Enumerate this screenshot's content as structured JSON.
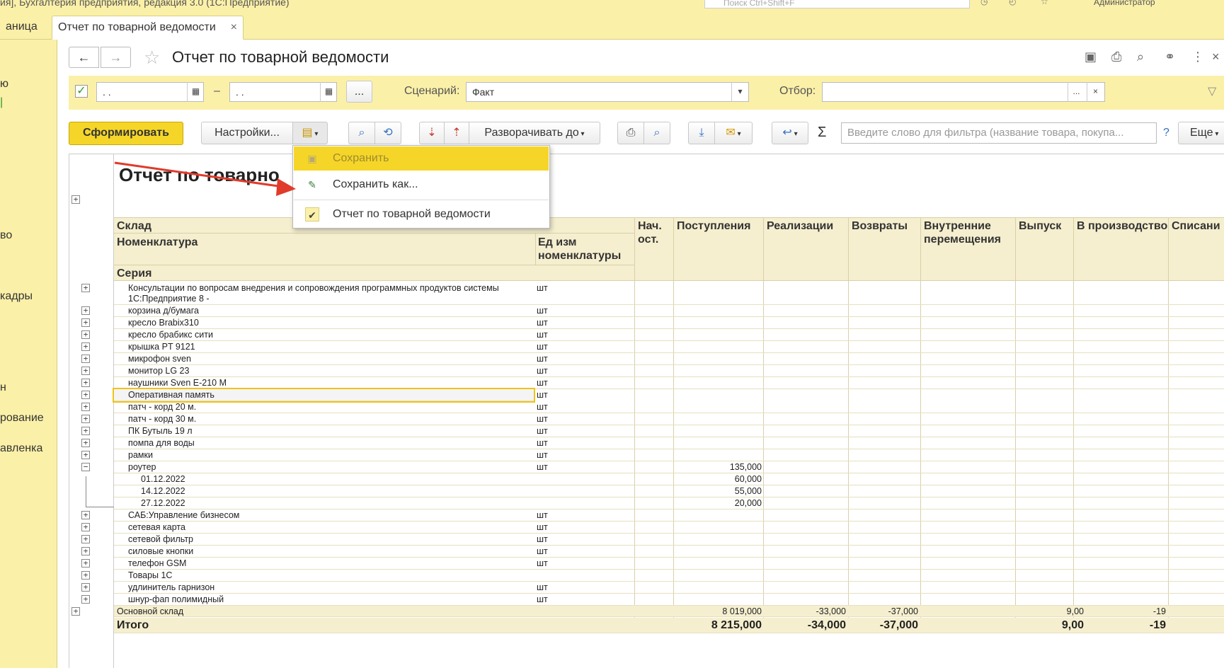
{
  "titlebar": {
    "text": "ия], Бухгалтерия предприятия, редакция 3.0 (1С:Предприятие)",
    "search_placeholder": "Поиск Ctrl+Shift+F",
    "user": "Администратор"
  },
  "tabs": {
    "home": "аница",
    "active": "Отчет по товарной ведомости",
    "close": "×"
  },
  "sidebar": [
    "ю",
    "ю",
    "во",
    "кадры",
    "н",
    "рование",
    "авленка"
  ],
  "header": {
    "title": "Отчет по товарной ведомости",
    "back": "←",
    "forward": "→"
  },
  "params": {
    "date_from": " .  .",
    "date_to": " .  .",
    "dash": "–",
    "ellipsis": "...",
    "scenario_label": "Сценарий:",
    "scenario_value": "Факт",
    "filter_label": "Отбор:",
    "filter_value": ""
  },
  "toolbar": {
    "generate": "Сформировать",
    "settings": "Настройки...",
    "expand_to": "Разворачивать до",
    "search_placeholder": "Введите слово для фильтра (название товара, покупа...",
    "help": "?",
    "more": "Еще",
    "sigma": "Σ"
  },
  "dropdown": {
    "items": [
      {
        "label": "Сохранить",
        "icon": "save-icon",
        "disabled": true
      },
      {
        "label": "Сохранить как...",
        "icon": "save-as-icon",
        "disabled": false
      },
      {
        "label": "Отчет по товарной ведомости",
        "icon": "check-icon",
        "disabled": false
      }
    ]
  },
  "report": {
    "title": "Отчет по товарно",
    "headers": {
      "sklad": "Склад",
      "nomenklatura": "Номенклатура",
      "unit": "Ед изм номенклатуры",
      "seria": "Серия",
      "nach": "Нач. ост.",
      "postupleniya": "Поступления",
      "realizacii": "Реализации",
      "vozvraty": "Возвраты",
      "vnutr": "Внутренние перемещения",
      "vypusk": "Выпуск",
      "v_proizv": "В производство",
      "spisano": "Списани"
    },
    "rows": [
      {
        "name": "Консультации по вопросам внедрения и сопровождения программных продуктов системы",
        "name2": "1С:Предприятие 8  -",
        "unit": "шт",
        "sign": "+"
      },
      {
        "name": "корзина д/бумага",
        "unit": "шт",
        "sign": "+"
      },
      {
        "name": "кресло Brabix310",
        "unit": "шт",
        "sign": "+"
      },
      {
        "name": "кресло брабикс сити",
        "unit": "шт",
        "sign": "+"
      },
      {
        "name": "крышка PT 9121",
        "unit": "шт",
        "sign": "+"
      },
      {
        "name": "микрофон sven",
        "unit": "шт",
        "sign": "+"
      },
      {
        "name": "монитор LG 23",
        "unit": "шт",
        "sign": "+"
      },
      {
        "name": "наушники Sven E-210 M",
        "unit": "шт",
        "sign": "+"
      },
      {
        "name": "Оперативная память",
        "unit": "шт",
        "sign": "+"
      },
      {
        "name": "патч - корд 20 м.",
        "unit": "шт",
        "sign": "+"
      },
      {
        "name": "патч - корд 30 м.",
        "unit": "шт",
        "sign": "+"
      },
      {
        "name": "ПК Бутыль 19 л",
        "unit": "шт",
        "sign": "+"
      },
      {
        "name": "помпа для воды",
        "unit": "шт",
        "sign": "+"
      },
      {
        "name": "рамки",
        "unit": "шт",
        "sign": "+"
      },
      {
        "name": "роутер",
        "unit": "шт",
        "sign": "−",
        "post": "135,000"
      },
      {
        "name": "01.12.2022",
        "unit": "",
        "sub": true,
        "post": "60,000"
      },
      {
        "name": "14.12.2022",
        "unit": "",
        "sub": true,
        "post": "55,000"
      },
      {
        "name": "27.12.2022",
        "unit": "",
        "sub": true,
        "post": "20,000"
      },
      {
        "name": "САБ:Управление бизнесом",
        "unit": "шт",
        "sign": "+"
      },
      {
        "name": "сетевая карта",
        "unit": "шт",
        "sign": "+"
      },
      {
        "name": "сетевой фильтр",
        "unit": "шт",
        "sign": "+"
      },
      {
        "name": "силовые кнопки",
        "unit": "шт",
        "sign": "+"
      },
      {
        "name": "телефон GSM",
        "unit": "шт",
        "sign": "+"
      },
      {
        "name": "Товары 1С",
        "unit": "",
        "sign": "+"
      },
      {
        "name": "удлинитель гарнизон",
        "unit": "шт",
        "sign": "+"
      },
      {
        "name": "шнур-фап полимидный",
        "unit": "шт",
        "sign": "+"
      }
    ],
    "warehouse": {
      "name": "Основной склад",
      "post": "8 019,000",
      "real": "-33,000",
      "vozv": "-37,000",
      "vyp": "9,00",
      "vpr": "-19"
    },
    "total": {
      "name": "Итого",
      "post": "8 215,000",
      "real": "-34,000",
      "vozv": "-37,000",
      "vyp": "9,00",
      "vpr": "-19"
    }
  }
}
